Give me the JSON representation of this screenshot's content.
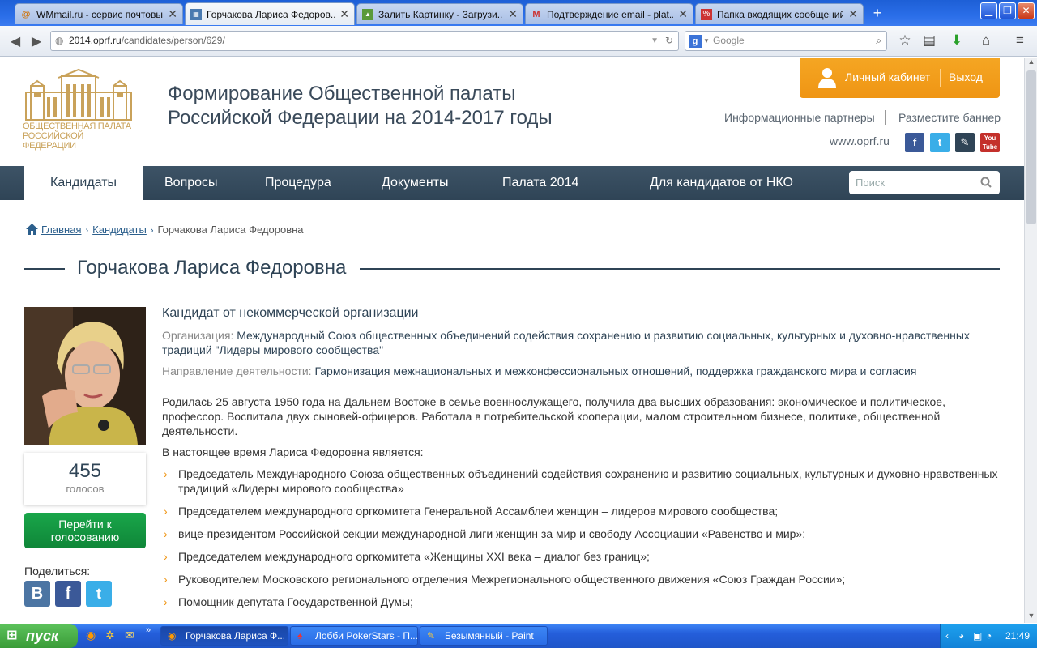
{
  "browser": {
    "tabs": [
      {
        "title": "WMmail.ru - сервис почтовы...",
        "icon": "@"
      },
      {
        "title": "Горчакова Лариса Федоров...",
        "icon": "op"
      },
      {
        "title": "Залить Картинку - Загрузи...",
        "icon": "img"
      },
      {
        "title": "Подтверждение email - plat...",
        "icon": "M"
      },
      {
        "title": "Папка входящих сообщений",
        "icon": "%"
      }
    ],
    "url_host": "2014.oprf.ru",
    "url_path": "/candidates/person/629/",
    "search_placeholder": "Google"
  },
  "site": {
    "logo_text": "ОБЩЕСТВЕННАЯ ПАЛАТА РОССИЙСКОЙ ФЕДЕРАЦИИ",
    "title": "Формирование Общественной палаты Российской Федерации на 2014-2017 годы",
    "cabinet_label": "Личный кабинет",
    "logout_label": "Выход",
    "partners_link": "Информационные партнеры",
    "banner_link": "Разместите баннер",
    "www": "www.oprf.ru",
    "social": [
      "facebook-icon",
      "twitter-icon",
      "livejournal-icon",
      "youtube-icon"
    ],
    "menu": [
      "Кандидаты",
      "Вопросы",
      "Процедура",
      "Документы",
      "Палата 2014",
      "Для кандидатов от НКО"
    ],
    "search_placeholder": "Поиск",
    "accent_color": "#ef9514",
    "nav_color": "#2f4456"
  },
  "breadcrumb": {
    "home": "Главная",
    "candidates": "Кандидаты",
    "current": "Горчакова Лариса Федоровна"
  },
  "person": {
    "name": "Горчакова Лариса Федоровна",
    "kind": "Кандидат от некоммерческой организации",
    "org_label": "Организация:",
    "org_value": "Международный Союз общественных объединений содействия сохранению и развитию социальных, культурных и духовно-нравственных традиций \"Лидеры мирового сообщества\"",
    "dir_label": "Направление деятельности:",
    "dir_value": "Гармонизация межнациональных и межконфессиональных отношений, поддержка гражданского мира и согласия",
    "bio": "Родилась 25 августа 1950 года на Дальнем Востоке в семье военнослужащего, получила  два высших образования: экономическое и политическое, профессор. Воспитала двух сыновей-офицеров. Работала в потребительской кооперации, малом строительном бизнесе, политике, общественной деятельности.",
    "current_intro": "В настоящее время Лариса Федоровна является:",
    "positions": [
      "Председатель Международного Союза общественных объединений содействия сохранению и развитию социальных, культурных и духовно-нравственных традиций «Лидеры мирового сообщества»",
      "Председателем международного оргкомитета Генеральной Ассамблеи женщин – лидеров мирового сообщества;",
      "вице-президентом Российской секции международной лиги женщин за мир и свободу Ассоциации «Равенство и мир»;",
      "Председателем международного оргкомитета «Женщины XXI века – диалог без границ»;",
      "Руководителем Московского регионального отделения Межрегионального общественного движения «Союз Граждан России»;",
      "Помощник депутата Государственной Думы;"
    ],
    "votes": "455",
    "votes_word": "голосов",
    "vote_button": "Перейти к голосованию",
    "share_label": "Поделиться:"
  },
  "taskbar": {
    "start": "пуск",
    "tasks": [
      "Горчакова Лариса Ф...",
      "Лобби PokerStars - П...",
      "Безымянный - Paint"
    ],
    "time": "21:49"
  }
}
